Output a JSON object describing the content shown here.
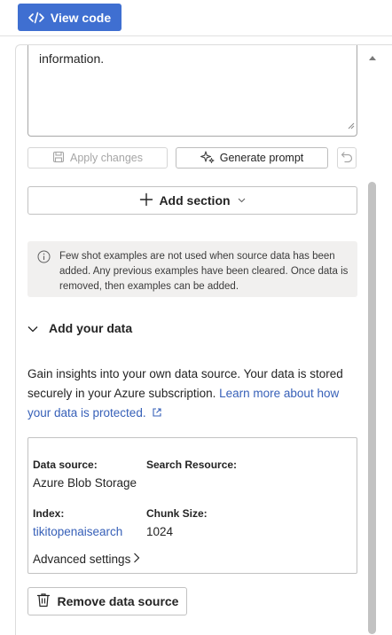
{
  "toolbar": {
    "view_code_label": "View code"
  },
  "prompt": {
    "textarea_value": "information.",
    "apply_label": "Apply changes",
    "generate_label": "Generate prompt"
  },
  "add_section": {
    "label": "Add section"
  },
  "info_message": "Few shot examples are not used when source data has been added. Any previous examples have been cleared. Once data is removed, then examples can be added.",
  "add_data": {
    "header": "Add your data",
    "description": "Gain insights into your own data source. Your data is stored securely in your Azure subscription.",
    "link_text": "Learn more about how your data is protected."
  },
  "data_source_card": {
    "data_source_label": "Data source:",
    "data_source_value": "Azure Blob Storage",
    "search_resource_label": "Search Resource:",
    "index_label": "Index:",
    "index_value": "tikitopenaisearch",
    "chunk_size_label": "Chunk Size:",
    "chunk_size_value": "1024",
    "advanced_settings_label": "Advanced settings"
  },
  "remove_button": {
    "label": "Remove data source"
  },
  "colors": {
    "accent": "#3f6fd1",
    "link": "#3760b8",
    "info_background": "#f1f0ef"
  },
  "icons": {
    "view_code": "code-icon",
    "apply": "save-icon",
    "generate": "sparkle-icon",
    "undo": "undo-icon",
    "add": "plus-icon",
    "info": "info-icon",
    "collapse": "chevron-down-icon",
    "external": "external-link-icon",
    "advanced": "chevron-right-icon",
    "remove": "trash-icon"
  }
}
